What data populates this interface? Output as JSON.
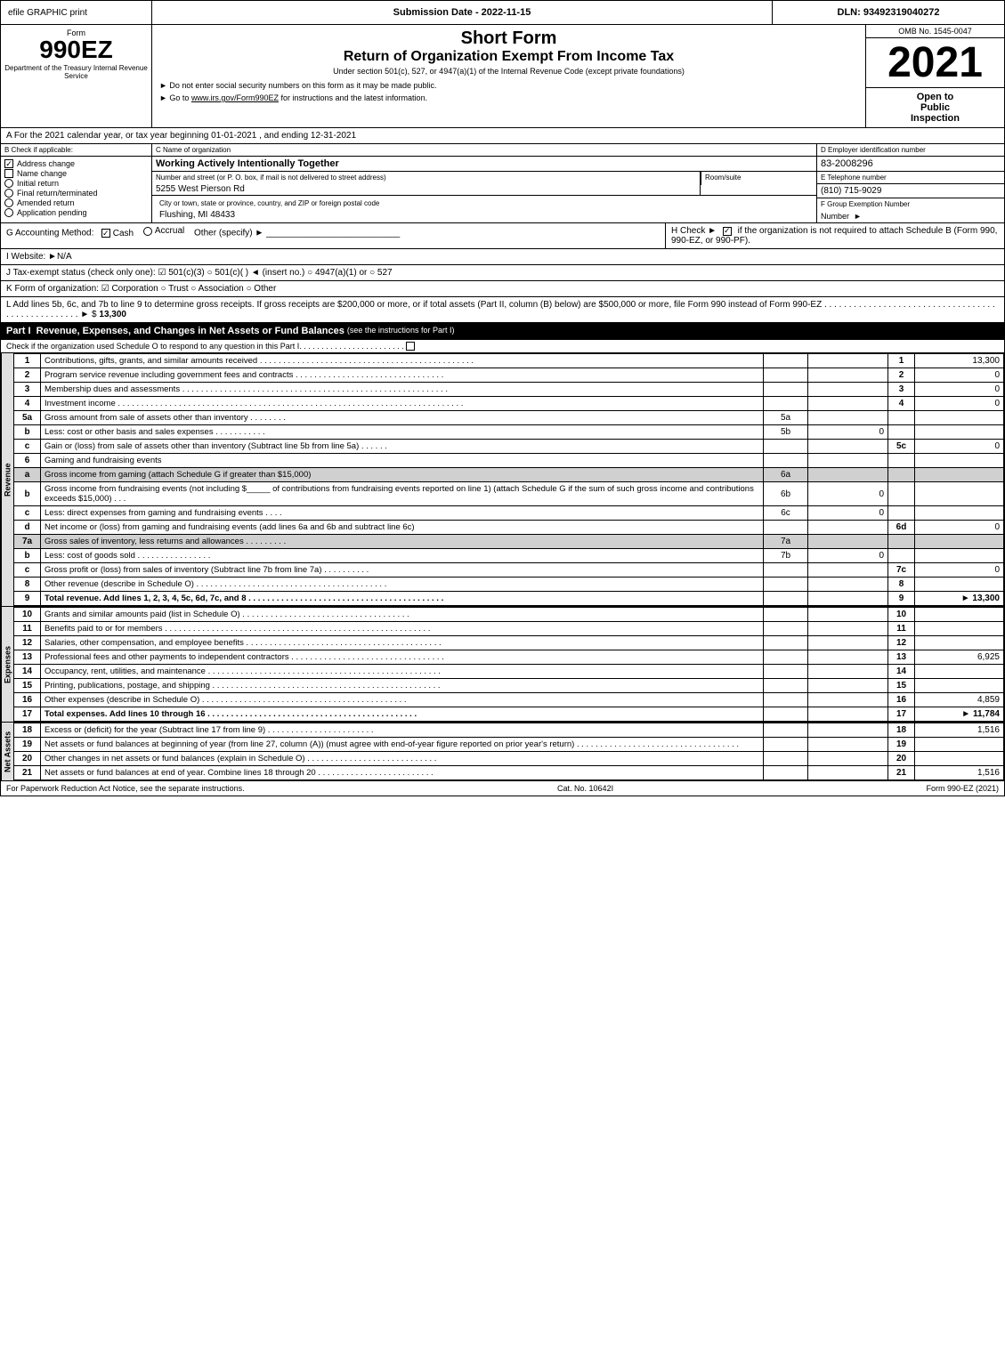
{
  "topbar": {
    "left": "efile GRAPHIC print",
    "mid": "Submission Date - 2022-11-15",
    "right": "DLN: 93492319040272"
  },
  "form": {
    "number": "990EZ",
    "department": "Department of the Treasury Internal Revenue Service",
    "short_form_title": "Short Form",
    "return_title": "Return of Organization Exempt From Income Tax",
    "instructions1": "Under section 501(c), 527, or 4947(a)(1) of the Internal Revenue Code (except private foundations)",
    "instructions2": "► Do not enter social security numbers on this form as it may be made public.",
    "instructions3": "► Go to",
    "irs_link": "www.irs.gov/Form990EZ",
    "instructions3b": "for instructions and the latest information.",
    "omb": "OMB No. 1545-0047",
    "year": "2021",
    "open_line1": "Open to",
    "open_line2": "Public",
    "open_line3": "Inspection"
  },
  "section_a": {
    "text": "A For the 2021 calendar year, or tax year beginning 01-01-2021 , and ending 12-31-2021"
  },
  "section_b": {
    "label": "B Check if applicable:",
    "items": [
      {
        "id": "address_change",
        "label": "Address change",
        "checked": true
      },
      {
        "id": "name_change",
        "label": "Name change",
        "checked": false
      },
      {
        "id": "initial_return",
        "label": "Initial return",
        "checked": false
      },
      {
        "id": "final_return",
        "label": "Final return/terminated",
        "checked": false
      },
      {
        "id": "amended_return",
        "label": "Amended return",
        "checked": false
      },
      {
        "id": "application_pending",
        "label": "Application pending",
        "checked": false
      }
    ]
  },
  "section_c": {
    "label": "C Name of organization",
    "org_name": "Working Actively Intentionally Together",
    "address_label": "Number and street (or P. O. box, if mail is not delivered to street address)",
    "address_value": "5255 West Pierson Rd",
    "room_label": "Room/suite",
    "room_value": "",
    "city_label": "City or town, state or province, country, and ZIP or foreign postal code",
    "city_value": "Flushing, MI  48433"
  },
  "section_d": {
    "label": "D Employer identification number",
    "ein": "83-2008296"
  },
  "section_e": {
    "label": "E Telephone number",
    "phone": "(810) 715-9029"
  },
  "section_f": {
    "label": "F Group Exemption Number",
    "value": "►"
  },
  "section_g": {
    "label": "G Accounting Method:",
    "cash": "Cash",
    "accrual": "Accrual",
    "other": "Other (specify) ►",
    "underline": "___________________________"
  },
  "section_h": {
    "text": "H Check ►",
    "check_label": "if the organization is not required to attach Schedule B (Form 990, 990-EZ, or 990-PF).",
    "checked": true
  },
  "section_i": {
    "label": "I Website: ►N/A"
  },
  "section_j": {
    "label": "J Tax-exempt status (check only one): ☑ 501(c)(3)  ○ 501(c)(   ) ◄ (insert no.)  ○ 4947(a)(1) or  ○ 527"
  },
  "section_k": {
    "label": "K Form of organization: ☑ Corporation   ○ Trust   ○ Association   ○ Other"
  },
  "section_l": {
    "text": "L Add lines 5b, 6c, and 7b to line 9 to determine gross receipts. If gross receipts are $200,000 or more, or if total assets (Part II, column (B) below) are $500,000 or more, file Form 990 instead of Form 990-EZ",
    "dots": " . . . . . . . . . . . . . . . . . . . . . . . . . . . . . . . . . . . . . . . . . . . . . . . . . .",
    "arrow": "► $",
    "value": "13,300"
  },
  "part1": {
    "title": "Part I",
    "section_title": "Revenue, Expenses, and Changes in Net Assets or Fund Balances",
    "section_sub": "(see the instructions for Part I)",
    "check_line": "Check if the organization used Schedule O to respond to any question in this Part I",
    "dots": " . . . . . . . . . . . . . . . . . . . . . . . .",
    "revenue_label": "Revenue",
    "expenses_label": "Expenses",
    "net_assets_label": "Net Assets",
    "rows": [
      {
        "num": "1",
        "label": "Contributions, gifts, grants, and similar amounts received",
        "dots": " . . . . . . . . . . . . . . . . . . . . . . . . . . . . . . . . . . . . . . . . . . . . . .",
        "ref": "",
        "val": "",
        "linenum": "1",
        "amount": "13,300",
        "shaded": false,
        "bold": false
      },
      {
        "num": "2",
        "label": "Program service revenue including government fees and contracts",
        "dots": " . . . . . . . . . . . . . . . . . . . . . . . . . . . . . . . .",
        "ref": "",
        "val": "",
        "linenum": "2",
        "amount": "0",
        "shaded": false,
        "bold": false
      },
      {
        "num": "3",
        "label": "Membership dues and assessments",
        "dots": " . . . . . . . . . . . . . . . . . . . . . . . . . . . . . . . . . . . . . . . . . . . . . . . . . . . . . . . . .",
        "ref": "",
        "val": "",
        "linenum": "3",
        "amount": "0",
        "shaded": false,
        "bold": false
      },
      {
        "num": "4",
        "label": "Investment income",
        "dots": " . . . . . . . . . . . . . . . . . . . . . . . . . . . . . . . . . . . . . . . . . . . . . . . . . . . . . . . . . . . . . . . . . . . . . . . . . .",
        "ref": "",
        "val": "",
        "linenum": "4",
        "amount": "0",
        "shaded": false,
        "bold": false
      },
      {
        "num": "5a",
        "label": "Gross amount from sale of assets other than inventory",
        "dots": " . . . . . . . .",
        "ref": "5a",
        "val": "",
        "linenum": "",
        "amount": "",
        "shaded": false,
        "bold": false
      },
      {
        "num": "b",
        "label": "Less: cost or other basis and sales expenses",
        "dots": " . . . . . . . . . . .",
        "ref": "5b",
        "val": "0",
        "linenum": "",
        "amount": "",
        "shaded": false,
        "bold": false
      },
      {
        "num": "c",
        "label": "Gain or (loss) from sale of assets other than inventory (Subtract line 5b from line 5a)",
        "dots": " . . . . . .",
        "ref": "",
        "val": "",
        "linenum": "5c",
        "amount": "0",
        "shaded": false,
        "bold": false
      },
      {
        "num": "6",
        "label": "Gaming and fundraising events",
        "dots": "",
        "ref": "",
        "val": "",
        "linenum": "",
        "amount": "",
        "shaded": false,
        "bold": false
      },
      {
        "num": "a",
        "label": "Gross income from gaming (attach Schedule G if greater than $15,000)",
        "dots": "",
        "ref": "6a",
        "val": "",
        "linenum": "",
        "amount": "",
        "shaded": true,
        "bold": false
      },
      {
        "num": "b",
        "label": "Gross income from fundraising events (not including $_____ of contributions from fundraising events reported on line 1) (attach Schedule G if the sum of such gross income and contributions exceeds $15,000)",
        "dots": " . . .",
        "ref": "6b",
        "val": "0",
        "linenum": "",
        "amount": "",
        "shaded": false,
        "bold": false
      },
      {
        "num": "c",
        "label": "Less: direct expenses from gaming and fundraising events",
        "dots": " . . . .",
        "ref": "6c",
        "val": "0",
        "linenum": "",
        "amount": "",
        "shaded": false,
        "bold": false
      },
      {
        "num": "d",
        "label": "Net income or (loss) from gaming and fundraising events (add lines 6a and 6b and subtract line 6c)",
        "dots": "",
        "ref": "",
        "val": "",
        "linenum": "6d",
        "amount": "0",
        "shaded": false,
        "bold": false
      },
      {
        "num": "7a",
        "label": "Gross sales of inventory, less returns and allowances",
        "dots": " . . . . . . . . .",
        "ref": "7a",
        "val": "",
        "linenum": "",
        "amount": "",
        "shaded": true,
        "bold": false
      },
      {
        "num": "b",
        "label": "Less: cost of goods sold         . . . . . . . . . . . . . . . .",
        "dots": "",
        "ref": "7b",
        "val": "0",
        "linenum": "",
        "amount": "",
        "shaded": false,
        "bold": false
      },
      {
        "num": "c",
        "label": "Gross profit or (loss) from sales of inventory (Subtract line 7b from line 7a)",
        "dots": " . . . . . . . . . .",
        "ref": "",
        "val": "",
        "linenum": "7c",
        "amount": "0",
        "shaded": false,
        "bold": false
      },
      {
        "num": "8",
        "label": "Other revenue (describe in Schedule O)",
        "dots": " . . . . . . . . . . . . . . . . . . . . . . . . . . . . . . . . . . . . . . . . .",
        "ref": "",
        "val": "",
        "linenum": "8",
        "amount": "",
        "shaded": false,
        "bold": false
      },
      {
        "num": "9",
        "label": "Total revenue. Add lines 1, 2, 3, 4, 5c, 6d, 7c, and 8",
        "dots": " . . . . . . . . . . . . . . . . . . . . . . . . . . . . . . . . . . . . . . . . . .",
        "ref": "",
        "val": "",
        "linenum": "9",
        "amount": "13,300",
        "shaded": false,
        "bold": true,
        "arrow": true
      }
    ],
    "expense_rows": [
      {
        "num": "10",
        "label": "Grants and similar amounts paid (list in Schedule O)",
        "dots": " . . . . . . . . . . . . . . . . . . . . . . . . . . . . . . . . . . . .",
        "linenum": "10",
        "amount": "",
        "shaded": false,
        "bold": false
      },
      {
        "num": "11",
        "label": "Benefits paid to or for members",
        "dots": " . . . . . . . . . . . . . . . . . . . . . . . . . . . . . . . . . . . . . . . . . . . . . . . . . . . . . . . . .",
        "linenum": "11",
        "amount": "",
        "shaded": false,
        "bold": false
      },
      {
        "num": "12",
        "label": "Salaries, other compensation, and employee benefits",
        "dots": " . . . . . . . . . . . . . . . . . . . . . . . . . . . . . . . . . . . . . . . . . .",
        "linenum": "12",
        "amount": "",
        "shaded": false,
        "bold": false
      },
      {
        "num": "13",
        "label": "Professional fees and other payments to independent contractors",
        "dots": " . . . . . . . . . . . . . . . . . . . . . . . . . . . . . . . . .",
        "linenum": "13",
        "amount": "6,925",
        "shaded": false,
        "bold": false
      },
      {
        "num": "14",
        "label": "Occupancy, rent, utilities, and maintenance",
        "dots": " . . . . . . . . . . . . . . . . . . . . . . . . . . . . . . . . . . . . . . . . . . . . . . . . . .",
        "linenum": "14",
        "amount": "",
        "shaded": false,
        "bold": false
      },
      {
        "num": "15",
        "label": "Printing, publications, postage, and shipping",
        "dots": " . . . . . . . . . . . . . . . . . . . . . . . . . . . . . . . . . . . . . . . . . . . . . . . . .",
        "linenum": "15",
        "amount": "",
        "shaded": false,
        "bold": false
      },
      {
        "num": "16",
        "label": "Other expenses (describe in Schedule O)",
        "dots": " . . . . . . . . . . . . . . . . . . . . . . . . . . . . . . . . . . . . . . . . . . . .",
        "linenum": "16",
        "amount": "4,859",
        "shaded": false,
        "bold": false
      },
      {
        "num": "17",
        "label": "Total expenses. Add lines 10 through 16",
        "dots": "   . . . . . . . . . . . . . . . . . . . . . . . . . . . . . . . . . . . . . . . . . . . . .",
        "linenum": "17",
        "amount": "11,784",
        "shaded": false,
        "bold": true,
        "arrow": true
      }
    ],
    "net_rows": [
      {
        "num": "18",
        "label": "Excess or (deficit) for the year (Subtract line 17 from line 9)         . . . . . . . . . . . . . . . . . . . . . . .",
        "dots": "",
        "linenum": "18",
        "amount": "1,516",
        "shaded": false,
        "bold": false
      },
      {
        "num": "19",
        "label": "Net assets or fund balances at beginning of year (from line 27, column (A)) (must agree with end-of-year figure reported on prior year's return)",
        "dots": " . . . . . . . . . . . . . . . . . . . . . . . . . . . . . . . . . . .",
        "linenum": "19",
        "amount": "",
        "shaded": false,
        "bold": false
      },
      {
        "num": "20",
        "label": "Other changes in net assets or fund balances (explain in Schedule O)",
        "dots": " . . . . . . . . . . . . . . . . . . . . . . . . . . . .",
        "linenum": "20",
        "amount": "",
        "shaded": false,
        "bold": false
      },
      {
        "num": "21",
        "label": "Net assets or fund balances at end of year. Combine lines 18 through 20",
        "dots": " . . . . . . . . . . . . . . . . . . . . . . . . .",
        "linenum": "21",
        "amount": "1,516",
        "shaded": false,
        "bold": false
      }
    ]
  },
  "footer": {
    "left": "For Paperwork Reduction Act Notice, see the separate instructions.",
    "cat": "Cat. No. 10642I",
    "right": "Form 990-EZ (2021)"
  }
}
